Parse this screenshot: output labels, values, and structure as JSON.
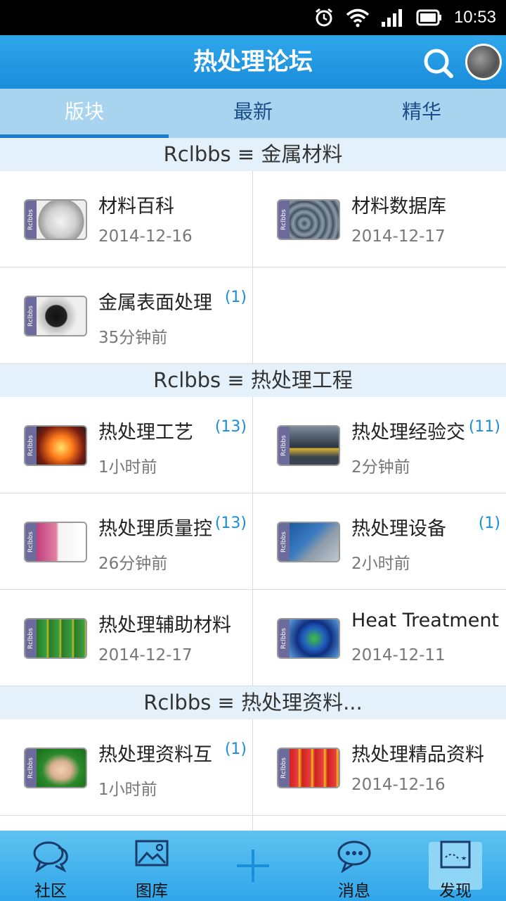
{
  "status": {
    "time": "10:53"
  },
  "header": {
    "title": "热处理论坛"
  },
  "tabs": [
    {
      "label": "版块",
      "active": true
    },
    {
      "label": "最新",
      "active": false
    },
    {
      "label": "精华",
      "active": false
    }
  ],
  "sections": [
    {
      "title": "Rclbbs ≡ 金属材料",
      "items": [
        {
          "name": "材料百科",
          "time": "2014-12-16",
          "count": "",
          "img": "wiki-globe"
        },
        {
          "name": "材料数据库",
          "time": "2014-12-17",
          "count": "",
          "img": "pipes"
        },
        {
          "name": "金属表面处理",
          "time": "35分钟前",
          "count": "(1)",
          "img": "cylinder-parts"
        }
      ]
    },
    {
      "title": "Rclbbs ≡ 热处理工程",
      "items": [
        {
          "name": "热处理工艺",
          "time": "1小时前",
          "count": "(13)",
          "img": "furnace"
        },
        {
          "name": "热处理经验交",
          "time": "2分钟前",
          "count": "(11)",
          "img": "gear-machine"
        },
        {
          "name": "热处理质量控",
          "time": "26分钟前",
          "count": "(13)",
          "img": "microscope"
        },
        {
          "name": "热处理设备",
          "time": "2小时前",
          "count": "(1)",
          "img": "equipment"
        },
        {
          "name": "热处理辅助材料",
          "time": "2014-12-17",
          "count": "",
          "img": "barrels"
        },
        {
          "name": "Heat Treatment",
          "time": "2014-12-11",
          "count": "",
          "img": "globe"
        }
      ]
    },
    {
      "title": "Rclbbs ≡ 热处理资料...",
      "items": [
        {
          "name": "热处理资料互",
          "time": "1小时前",
          "count": "(1)",
          "img": "handshake"
        },
        {
          "name": "热处理精品资料",
          "time": "2014-12-16",
          "count": "",
          "img": "fire-extinguishers"
        }
      ]
    }
  ],
  "thumb_brand": "Rclbbs",
  "bottom_nav": [
    {
      "label": "社区",
      "icon": "chat-bubbles-icon"
    },
    {
      "label": "图库",
      "icon": "image-icon"
    },
    {
      "label": "",
      "icon": "plus-icon"
    },
    {
      "label": "消息",
      "icon": "message-icon"
    },
    {
      "label": "发现",
      "icon": "map-flag-icon"
    }
  ],
  "colors": {
    "accent": "#1a8ddb",
    "tab_bg": "#a8d4ef",
    "section_bg": "#e4f1fa"
  }
}
